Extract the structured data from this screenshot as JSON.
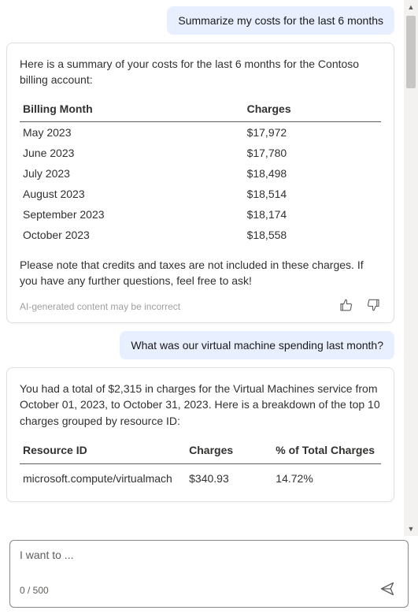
{
  "messages": {
    "user1": "Summarize my costs for the last 6 months",
    "ai1_intro": "Here is a summary of your costs for the last 6 months for the Contoso billing account:",
    "ai1_outro": "Please note that credits and taxes are not included in these charges. If you have any further questions, feel free to ask!",
    "user2": "What was our virtual machine spending last month?",
    "ai2_intro": "You had a total of $2,315 in charges for the Virtual Machines service from October 01, 2023, to October 31, 2023. Here is a breakdown of the top 10 charges grouped by resource ID:"
  },
  "billing_table": {
    "headers": {
      "month": "Billing Month",
      "charges": "Charges"
    },
    "rows": [
      {
        "month": "May 2023",
        "charges": "$17,972"
      },
      {
        "month": "June 2023",
        "charges": "$17,780"
      },
      {
        "month": "July 2023",
        "charges": "$18,498"
      },
      {
        "month": "August 2023",
        "charges": "$18,514"
      },
      {
        "month": "September 2023",
        "charges": "$18,174"
      },
      {
        "month": "October 2023",
        "charges": "$18,558"
      }
    ]
  },
  "resource_table": {
    "headers": {
      "id": "Resource ID",
      "charges": "Charges",
      "pct": "% of Total Charges"
    },
    "rows": [
      {
        "id": "microsoft.compute/virtualmach",
        "charges": "$340.93",
        "pct": "14.72%"
      }
    ]
  },
  "disclaimer": "AI-generated content may be incorrect",
  "composer": {
    "placeholder": "I want to ...",
    "counter": "0 / 500"
  }
}
